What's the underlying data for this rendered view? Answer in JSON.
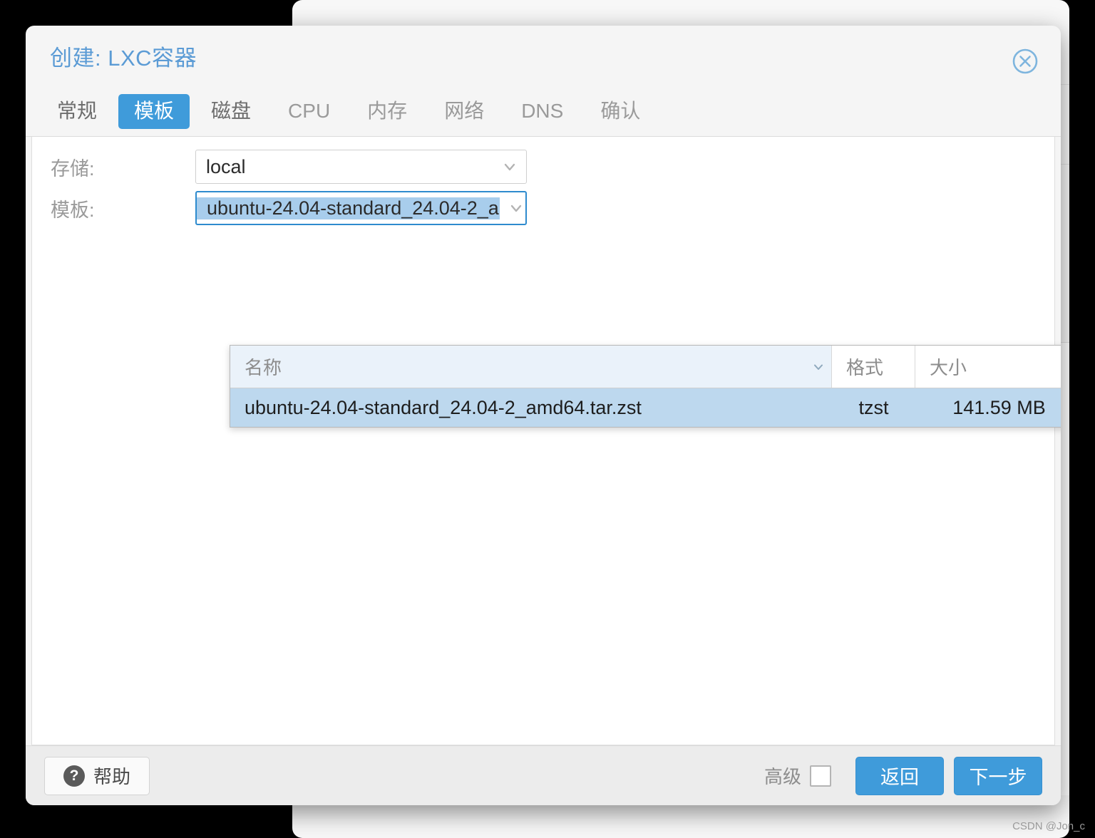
{
  "dialog": {
    "title": "创建: LXC容器",
    "close_icon": "close-circle-icon"
  },
  "tabs": [
    {
      "label": "常规",
      "active": false,
      "enabled": true
    },
    {
      "label": "模板",
      "active": true,
      "enabled": true
    },
    {
      "label": "磁盘",
      "active": false,
      "enabled": true
    },
    {
      "label": "CPU",
      "active": false,
      "enabled": false
    },
    {
      "label": "内存",
      "active": false,
      "enabled": false
    },
    {
      "label": "网络",
      "active": false,
      "enabled": false
    },
    {
      "label": "DNS",
      "active": false,
      "enabled": false
    },
    {
      "label": "确认",
      "active": false,
      "enabled": false
    }
  ],
  "form": {
    "storage": {
      "label": "存储:",
      "value": "local",
      "chevron": "chevron-down-icon"
    },
    "template": {
      "label": "模板:",
      "value": "ubuntu-24.04-standard_24.04-2_a",
      "chevron": "chevron-down-icon"
    }
  },
  "dropdown": {
    "columns": [
      "名称",
      "格式",
      "大小"
    ],
    "sort_icon": "chevron-down-icon",
    "rows": [
      {
        "name": "ubuntu-24.04-standard_24.04-2_amd64.tar.zst",
        "format": "tzst",
        "size": "141.59 MB",
        "selected": true
      }
    ]
  },
  "footer": {
    "help_label": "帮助",
    "help_icon": "question-mark-icon",
    "advanced_label": "高级",
    "advanced_checked": false,
    "back_label": "返回",
    "next_label": "下一步"
  },
  "watermark": "CSDN @Jon_c",
  "colors": {
    "accent": "#3f9bda",
    "title": "#5b9bd5",
    "selection": "#a8cdec",
    "row_selected": "#bdd8ee",
    "header_tint": "#eaf2fa"
  }
}
